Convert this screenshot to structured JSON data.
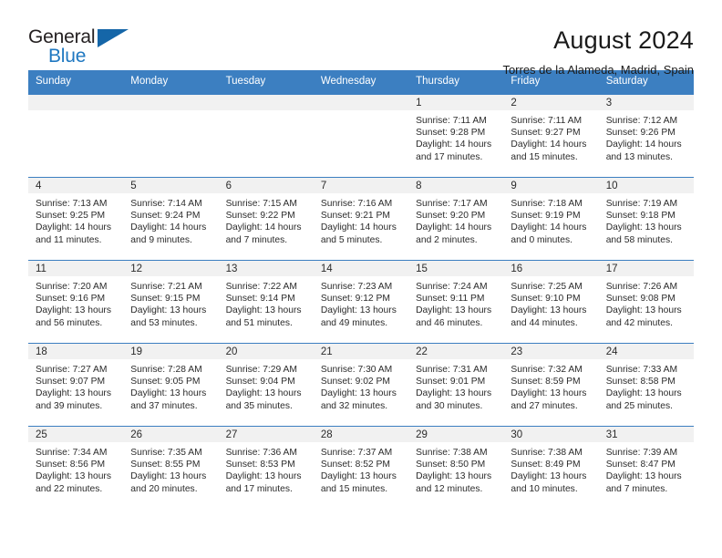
{
  "brand": {
    "name_part1": "General",
    "name_part2": "Blue",
    "accent_color": "#1f78c1",
    "triangle_color": "#1566a8"
  },
  "header": {
    "title": "August 2024",
    "subtitle": "Torres de la Alameda, Madrid, Spain"
  },
  "calendar": {
    "header_bg": "#3c7fc1",
    "daynum_bg": "#f1f1f1",
    "weekdays": [
      "Sunday",
      "Monday",
      "Tuesday",
      "Wednesday",
      "Thursday",
      "Friday",
      "Saturday"
    ],
    "weeks": [
      [
        {
          "day": "",
          "sunrise": "",
          "sunset": "",
          "daylight_line1": "",
          "daylight_line2": ""
        },
        {
          "day": "",
          "sunrise": "",
          "sunset": "",
          "daylight_line1": "",
          "daylight_line2": ""
        },
        {
          "day": "",
          "sunrise": "",
          "sunset": "",
          "daylight_line1": "",
          "daylight_line2": ""
        },
        {
          "day": "",
          "sunrise": "",
          "sunset": "",
          "daylight_line1": "",
          "daylight_line2": ""
        },
        {
          "day": "1",
          "sunrise": "Sunrise: 7:11 AM",
          "sunset": "Sunset: 9:28 PM",
          "daylight_line1": "Daylight: 14 hours",
          "daylight_line2": "and 17 minutes."
        },
        {
          "day": "2",
          "sunrise": "Sunrise: 7:11 AM",
          "sunset": "Sunset: 9:27 PM",
          "daylight_line1": "Daylight: 14 hours",
          "daylight_line2": "and 15 minutes."
        },
        {
          "day": "3",
          "sunrise": "Sunrise: 7:12 AM",
          "sunset": "Sunset: 9:26 PM",
          "daylight_line1": "Daylight: 14 hours",
          "daylight_line2": "and 13 minutes."
        }
      ],
      [
        {
          "day": "4",
          "sunrise": "Sunrise: 7:13 AM",
          "sunset": "Sunset: 9:25 PM",
          "daylight_line1": "Daylight: 14 hours",
          "daylight_line2": "and 11 minutes."
        },
        {
          "day": "5",
          "sunrise": "Sunrise: 7:14 AM",
          "sunset": "Sunset: 9:24 PM",
          "daylight_line1": "Daylight: 14 hours",
          "daylight_line2": "and 9 minutes."
        },
        {
          "day": "6",
          "sunrise": "Sunrise: 7:15 AM",
          "sunset": "Sunset: 9:22 PM",
          "daylight_line1": "Daylight: 14 hours",
          "daylight_line2": "and 7 minutes."
        },
        {
          "day": "7",
          "sunrise": "Sunrise: 7:16 AM",
          "sunset": "Sunset: 9:21 PM",
          "daylight_line1": "Daylight: 14 hours",
          "daylight_line2": "and 5 minutes."
        },
        {
          "day": "8",
          "sunrise": "Sunrise: 7:17 AM",
          "sunset": "Sunset: 9:20 PM",
          "daylight_line1": "Daylight: 14 hours",
          "daylight_line2": "and 2 minutes."
        },
        {
          "day": "9",
          "sunrise": "Sunrise: 7:18 AM",
          "sunset": "Sunset: 9:19 PM",
          "daylight_line1": "Daylight: 14 hours",
          "daylight_line2": "and 0 minutes."
        },
        {
          "day": "10",
          "sunrise": "Sunrise: 7:19 AM",
          "sunset": "Sunset: 9:18 PM",
          "daylight_line1": "Daylight: 13 hours",
          "daylight_line2": "and 58 minutes."
        }
      ],
      [
        {
          "day": "11",
          "sunrise": "Sunrise: 7:20 AM",
          "sunset": "Sunset: 9:16 PM",
          "daylight_line1": "Daylight: 13 hours",
          "daylight_line2": "and 56 minutes."
        },
        {
          "day": "12",
          "sunrise": "Sunrise: 7:21 AM",
          "sunset": "Sunset: 9:15 PM",
          "daylight_line1": "Daylight: 13 hours",
          "daylight_line2": "and 53 minutes."
        },
        {
          "day": "13",
          "sunrise": "Sunrise: 7:22 AM",
          "sunset": "Sunset: 9:14 PM",
          "daylight_line1": "Daylight: 13 hours",
          "daylight_line2": "and 51 minutes."
        },
        {
          "day": "14",
          "sunrise": "Sunrise: 7:23 AM",
          "sunset": "Sunset: 9:12 PM",
          "daylight_line1": "Daylight: 13 hours",
          "daylight_line2": "and 49 minutes."
        },
        {
          "day": "15",
          "sunrise": "Sunrise: 7:24 AM",
          "sunset": "Sunset: 9:11 PM",
          "daylight_line1": "Daylight: 13 hours",
          "daylight_line2": "and 46 minutes."
        },
        {
          "day": "16",
          "sunrise": "Sunrise: 7:25 AM",
          "sunset": "Sunset: 9:10 PM",
          "daylight_line1": "Daylight: 13 hours",
          "daylight_line2": "and 44 minutes."
        },
        {
          "day": "17",
          "sunrise": "Sunrise: 7:26 AM",
          "sunset": "Sunset: 9:08 PM",
          "daylight_line1": "Daylight: 13 hours",
          "daylight_line2": "and 42 minutes."
        }
      ],
      [
        {
          "day": "18",
          "sunrise": "Sunrise: 7:27 AM",
          "sunset": "Sunset: 9:07 PM",
          "daylight_line1": "Daylight: 13 hours",
          "daylight_line2": "and 39 minutes."
        },
        {
          "day": "19",
          "sunrise": "Sunrise: 7:28 AM",
          "sunset": "Sunset: 9:05 PM",
          "daylight_line1": "Daylight: 13 hours",
          "daylight_line2": "and 37 minutes."
        },
        {
          "day": "20",
          "sunrise": "Sunrise: 7:29 AM",
          "sunset": "Sunset: 9:04 PM",
          "daylight_line1": "Daylight: 13 hours",
          "daylight_line2": "and 35 minutes."
        },
        {
          "day": "21",
          "sunrise": "Sunrise: 7:30 AM",
          "sunset": "Sunset: 9:02 PM",
          "daylight_line1": "Daylight: 13 hours",
          "daylight_line2": "and 32 minutes."
        },
        {
          "day": "22",
          "sunrise": "Sunrise: 7:31 AM",
          "sunset": "Sunset: 9:01 PM",
          "daylight_line1": "Daylight: 13 hours",
          "daylight_line2": "and 30 minutes."
        },
        {
          "day": "23",
          "sunrise": "Sunrise: 7:32 AM",
          "sunset": "Sunset: 8:59 PM",
          "daylight_line1": "Daylight: 13 hours",
          "daylight_line2": "and 27 minutes."
        },
        {
          "day": "24",
          "sunrise": "Sunrise: 7:33 AM",
          "sunset": "Sunset: 8:58 PM",
          "daylight_line1": "Daylight: 13 hours",
          "daylight_line2": "and 25 minutes."
        }
      ],
      [
        {
          "day": "25",
          "sunrise": "Sunrise: 7:34 AM",
          "sunset": "Sunset: 8:56 PM",
          "daylight_line1": "Daylight: 13 hours",
          "daylight_line2": "and 22 minutes."
        },
        {
          "day": "26",
          "sunrise": "Sunrise: 7:35 AM",
          "sunset": "Sunset: 8:55 PM",
          "daylight_line1": "Daylight: 13 hours",
          "daylight_line2": "and 20 minutes."
        },
        {
          "day": "27",
          "sunrise": "Sunrise: 7:36 AM",
          "sunset": "Sunset: 8:53 PM",
          "daylight_line1": "Daylight: 13 hours",
          "daylight_line2": "and 17 minutes."
        },
        {
          "day": "28",
          "sunrise": "Sunrise: 7:37 AM",
          "sunset": "Sunset: 8:52 PM",
          "daylight_line1": "Daylight: 13 hours",
          "daylight_line2": "and 15 minutes."
        },
        {
          "day": "29",
          "sunrise": "Sunrise: 7:38 AM",
          "sunset": "Sunset: 8:50 PM",
          "daylight_line1": "Daylight: 13 hours",
          "daylight_line2": "and 12 minutes."
        },
        {
          "day": "30",
          "sunrise": "Sunrise: 7:38 AM",
          "sunset": "Sunset: 8:49 PM",
          "daylight_line1": "Daylight: 13 hours",
          "daylight_line2": "and 10 minutes."
        },
        {
          "day": "31",
          "sunrise": "Sunrise: 7:39 AM",
          "sunset": "Sunset: 8:47 PM",
          "daylight_line1": "Daylight: 13 hours",
          "daylight_line2": "and 7 minutes."
        }
      ]
    ]
  }
}
